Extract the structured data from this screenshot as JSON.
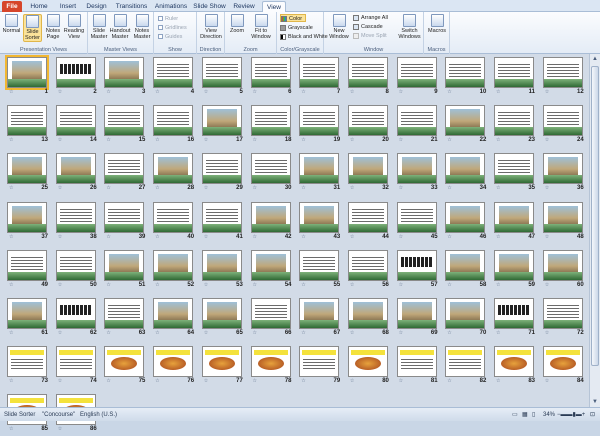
{
  "tabs": [
    "File",
    "Home",
    "Insert",
    "Design",
    "Transitions",
    "Animations",
    "Slide Show",
    "Review",
    "View"
  ],
  "active_tab": "View",
  "ribbon": {
    "presentation_views": {
      "label": "Presentation Views",
      "buttons": [
        "Normal",
        "Slide Sorter",
        "Notes Page",
        "Reading View"
      ]
    },
    "master_views": {
      "label": "Master Views",
      "buttons": [
        "Slide Master",
        "Handout Master",
        "Notes Master"
      ]
    },
    "show": {
      "label": "Show",
      "items": [
        "Ruler",
        "Gridlines",
        "Guides"
      ]
    },
    "direction": {
      "label": "Direction",
      "button": "View Direction"
    },
    "zoom": {
      "label": "Zoom",
      "buttons": [
        "Zoom",
        "Fit to Window"
      ]
    },
    "color": {
      "label": "Color/Grayscale",
      "items": [
        "Color",
        "Grayscale",
        "Black and White"
      ]
    },
    "window": {
      "label": "Window",
      "buttons": [
        "New Window",
        "Switch Windows"
      ],
      "items": [
        "Arrange All",
        "Cascade",
        "Move Split"
      ]
    },
    "macros": {
      "label": "Macros",
      "button": "Macros"
    }
  },
  "slides": {
    "total": 86,
    "selected": 1,
    "yellow_slides": [
      73,
      74,
      75,
      76,
      77,
      78,
      79,
      80,
      81,
      82,
      83,
      84,
      85,
      86
    ],
    "photo_slides": [
      1,
      3,
      17,
      22,
      25,
      26,
      28,
      31,
      32,
      33,
      34,
      36,
      37,
      42,
      43,
      46,
      47,
      48,
      51,
      52,
      53,
      54,
      58,
      59,
      60,
      61,
      62,
      64,
      65,
      67,
      68,
      69,
      70
    ],
    "food_slides": [
      75,
      76,
      77,
      78,
      80,
      83,
      84,
      85,
      86
    ],
    "title_slides": [
      2,
      57,
      62,
      71
    ]
  },
  "status": {
    "view": "Slide Sorter",
    "theme": "\"Concourse\"",
    "language": "English (U.S.)",
    "zoom": "34%"
  },
  "colors": {
    "accent": "#f1b732",
    "file_tab": "#d6452a",
    "band": "#2f6a35"
  }
}
